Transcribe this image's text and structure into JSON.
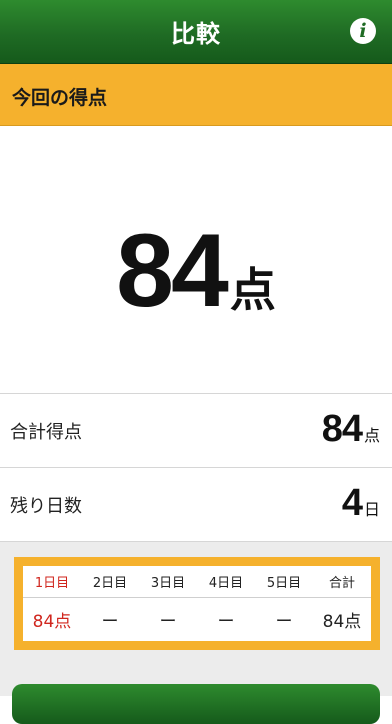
{
  "navbar": {
    "title": "比較",
    "info_label": "i"
  },
  "section": {
    "title": "今回の得点"
  },
  "score": {
    "value": "84",
    "unit": "点"
  },
  "summary": {
    "total": {
      "label": "合計得点",
      "value": "84",
      "unit": "点"
    },
    "days_left": {
      "label": "残り日数",
      "value": "4",
      "unit": "日"
    }
  },
  "table": {
    "headers": [
      "1日目",
      "2日目",
      "3日目",
      "4日目",
      "5日目",
      "合計"
    ],
    "values": [
      "84点",
      "ー",
      "ー",
      "ー",
      "ー",
      "84点"
    ]
  },
  "colors": {
    "navbar_green": "#1f6b24",
    "header_orange": "#f5b12d",
    "current_day_red": "#d0261e"
  }
}
